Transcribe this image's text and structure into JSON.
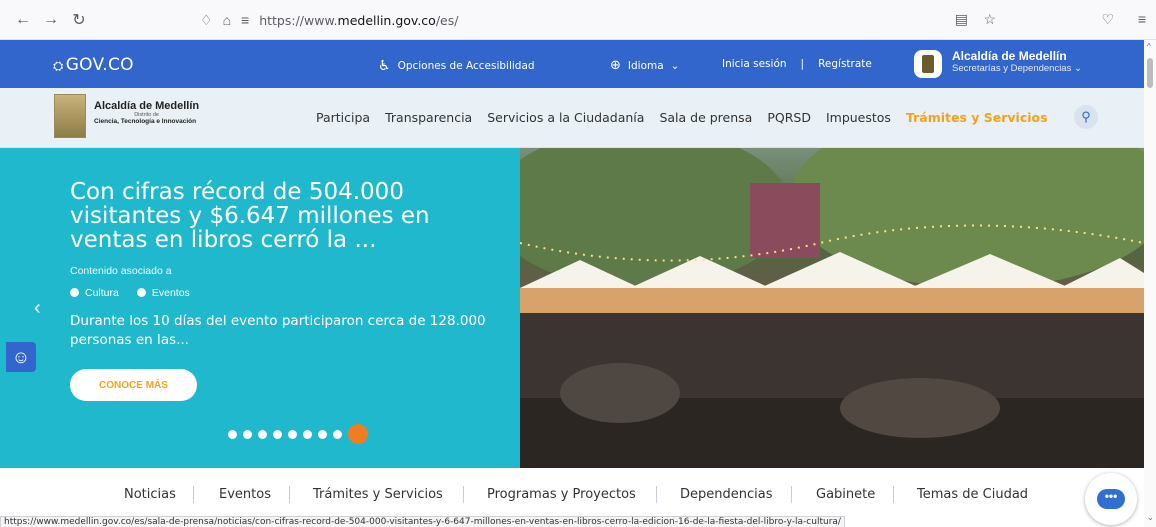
{
  "browser": {
    "url_prefix": "https://www.",
    "url_domain": "medellin.gov.co",
    "url_path": "/es/"
  },
  "gov_bar": {
    "logo": "GOV.CO",
    "accessibility": "Opciones de Accesibilidad",
    "language": "Idioma",
    "login": "Inicia sesión",
    "register": "Regístrate",
    "entity_name": "Alcaldía de Medellín",
    "entity_sub": "Secretarías y Dependencias"
  },
  "site_header": {
    "logo_title": "Alcaldía de Medellín",
    "logo_district": "Distrito de",
    "logo_subtitle": "Ciencia, Tecnología e Innovación",
    "menu": [
      "Participa",
      "Transparencia",
      "Servicios a la Ciudadanía",
      "Sala de prensa",
      "PQRSD",
      "Impuestos",
      "Trámites y Servicios"
    ],
    "active_item_index": 6
  },
  "hero": {
    "title": "Con cifras récord de 504.000 visitantes y $6.647 millones en ventas en libros cerró la ...",
    "associated_label": "Contenido asociado a",
    "tags": [
      "Cultura",
      "Eventos"
    ],
    "description": "Durante los 10 días del evento participaron cerca de 128.000 personas en las...",
    "cta": "CONOCE MÁS",
    "slide_count": 9,
    "current_slide": 9
  },
  "bottom_nav": {
    "items": [
      "Noticias",
      "Eventos",
      "Trámites y Servicios",
      "Programas y Proyectos",
      "Dependencias",
      "Gabinete",
      "Temas de Ciudad"
    ]
  },
  "status_url": "https://www.medellin.gov.co/es/sala-de-prensa/noticias/con-cifras-record-de-504-000-visitantes-y-6-647-millones-en-ventas-en-libros-cerro-la-edicion-16-de-la-fiesta-del-libro-y-la-cultura/",
  "colors": {
    "gov_blue": "#3366cc",
    "hero_teal": "#20b8cc",
    "accent_orange": "#f4a21a"
  }
}
